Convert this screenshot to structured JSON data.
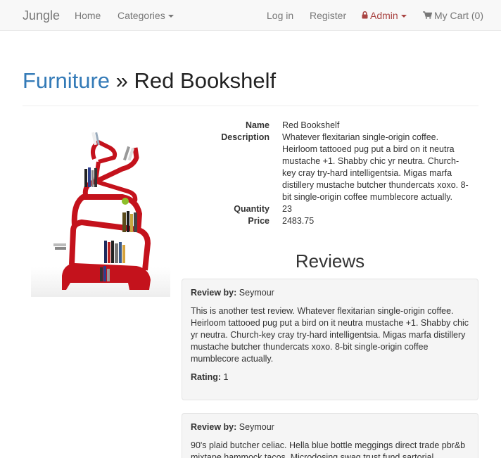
{
  "navbar": {
    "brand": "Jungle",
    "home": "Home",
    "categories": "Categories",
    "login": "Log in",
    "register": "Register",
    "admin": "Admin",
    "cart": "My Cart (0)"
  },
  "colors": {
    "link": "#337ab7",
    "admin": "#a94442",
    "product": "#c4121c"
  },
  "title": {
    "category": "Furniture",
    "separator": "»",
    "product": "Red Bookshelf"
  },
  "product": {
    "name_label": "Name",
    "name": "Red Bookshelf",
    "description_label": "Description",
    "description": "Whatever flexitarian single-origin coffee. Heirloom tattooed pug put a bird on it neutra mustache +1. Shabby chic yr neutra. Church-key cray try-hard intelligentsia. Migas marfa distillery mustache butcher thundercats xoxo. 8-bit single-origin coffee mumblecore actually.",
    "quantity_label": "Quantity",
    "quantity": "23",
    "price_label": "Price",
    "price": "2483.75"
  },
  "reviews": {
    "heading": "Reviews",
    "items": [
      {
        "by_label": "Review by:",
        "author": "Seymour",
        "body": "This is another test review. Whatever flexitarian single-origin coffee. Heirloom tattooed pug put a bird on it neutra mustache +1. Shabby chic yr neutra. Church-key cray try-hard intelligentsia. Migas marfa distillery mustache butcher thundercats xoxo. 8-bit single-origin coffee mumblecore actually.",
        "rating_label": "Rating:",
        "rating": "1"
      },
      {
        "by_label": "Review by:",
        "author": "Seymour",
        "body": "90's plaid butcher celiac. Hella blue bottle meggings direct trade pbr&b mixtape hammock tacos. Microdosing swag trust fund sartorial"
      }
    ]
  }
}
